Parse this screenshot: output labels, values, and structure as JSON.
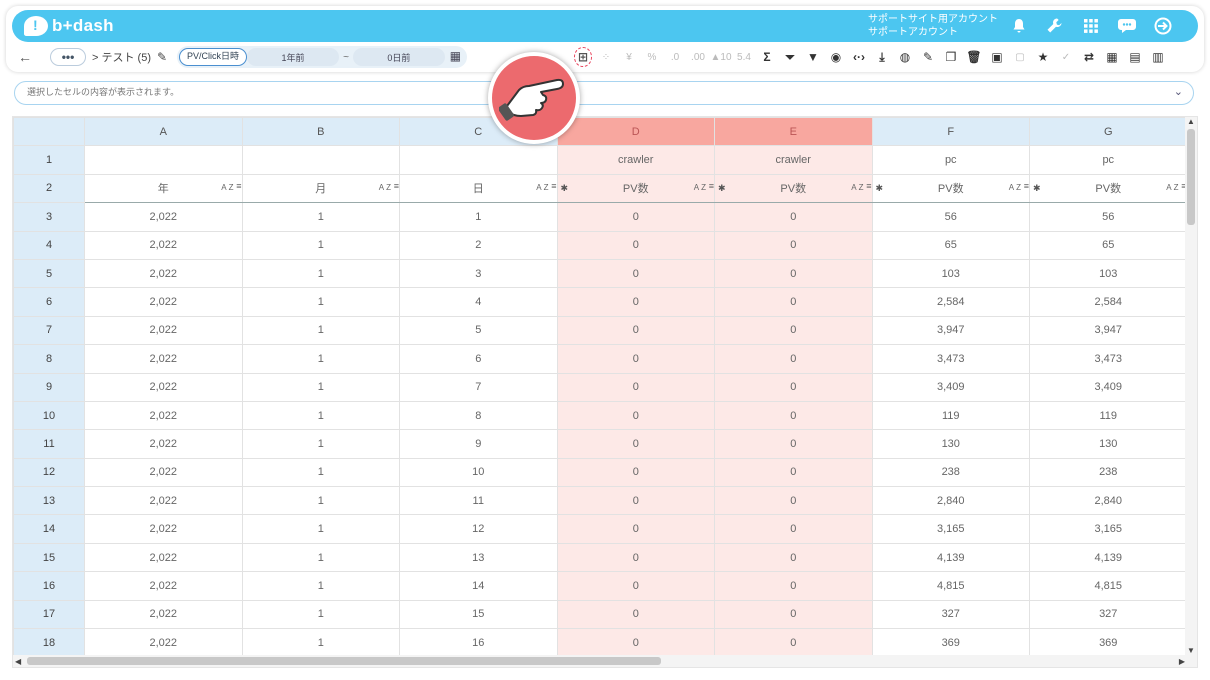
{
  "app": {
    "brand": "b+dash"
  },
  "account": {
    "line1": "サポートサイト用アカウント",
    "line2": "サポートアカウント"
  },
  "toolbar": {
    "back": "←",
    "more": "•••",
    "breadcrumb": "> テスト (5)",
    "date_type": "PV/Click日時",
    "date_from": "1年前",
    "date_sep": "~",
    "date_to": "0日前"
  },
  "tools": [
    {
      "name": "layout-icon",
      "glyph": "⊞"
    },
    {
      "name": "spinner-icon",
      "glyph": "⁘"
    },
    {
      "name": "yen-icon",
      "glyph": "¥"
    },
    {
      "name": "percent-icon",
      "glyph": "%"
    },
    {
      "name": "decimal-decrease-icon",
      "glyph": ".0"
    },
    {
      "name": "decimal-increase-icon",
      "glyph": ".00"
    },
    {
      "name": "increase-icon",
      "glyph": "▲10"
    },
    {
      "name": "decrease-icon",
      "glyph": "5.4"
    },
    {
      "name": "sum-icon",
      "glyph": "Σ"
    },
    {
      "name": "filter-clear-icon",
      "glyph": "⏷"
    },
    {
      "name": "filter-icon",
      "glyph": "▼"
    },
    {
      "name": "eye-icon",
      "glyph": "◉"
    },
    {
      "name": "code-icon",
      "glyph": "‹·›"
    },
    {
      "name": "download-icon",
      "glyph": "⤓"
    },
    {
      "name": "chart-icon",
      "glyph": "◍"
    },
    {
      "name": "edit-icon",
      "glyph": "✎"
    },
    {
      "name": "copy-icon",
      "glyph": "❐"
    },
    {
      "name": "trash-icon",
      "glyph": "🗑"
    },
    {
      "name": "archive-icon",
      "glyph": "▣"
    },
    {
      "name": "archive-disabled-icon",
      "glyph": "▢"
    },
    {
      "name": "star-icon",
      "glyph": "★"
    },
    {
      "name": "user-check-icon",
      "glyph": "✓"
    },
    {
      "name": "swap-icon",
      "glyph": "⇄"
    },
    {
      "name": "calendar-icon",
      "glyph": "▦"
    },
    {
      "name": "document-icon",
      "glyph": "▤"
    },
    {
      "name": "clipboard-icon",
      "glyph": "▥"
    }
  ],
  "message_bar": {
    "text": "選択したセルの内容が表示されます。"
  },
  "grid": {
    "columns": [
      "A",
      "B",
      "C",
      "D",
      "E",
      "F",
      "G"
    ],
    "group_row": [
      "",
      "",
      "",
      "crawler",
      "crawler",
      "pc",
      "pc"
    ],
    "header_row": [
      "年",
      "月",
      "日",
      "PV数",
      "PV数",
      "PV数",
      "PV数"
    ],
    "sort_label": "AZ",
    "rows": [
      {
        "n": "3",
        "cells": [
          "2,022",
          "1",
          "1",
          "0",
          "0",
          "56",
          "56"
        ]
      },
      {
        "n": "4",
        "cells": [
          "2,022",
          "1",
          "2",
          "0",
          "0",
          "65",
          "65"
        ]
      },
      {
        "n": "5",
        "cells": [
          "2,022",
          "1",
          "3",
          "0",
          "0",
          "103",
          "103"
        ]
      },
      {
        "n": "6",
        "cells": [
          "2,022",
          "1",
          "4",
          "0",
          "0",
          "2,584",
          "2,584"
        ]
      },
      {
        "n": "7",
        "cells": [
          "2,022",
          "1",
          "5",
          "0",
          "0",
          "3,947",
          "3,947"
        ]
      },
      {
        "n": "8",
        "cells": [
          "2,022",
          "1",
          "6",
          "0",
          "0",
          "3,473",
          "3,473"
        ]
      },
      {
        "n": "9",
        "cells": [
          "2,022",
          "1",
          "7",
          "0",
          "0",
          "3,409",
          "3,409"
        ]
      },
      {
        "n": "10",
        "cells": [
          "2,022",
          "1",
          "8",
          "0",
          "0",
          "119",
          "119"
        ]
      },
      {
        "n": "11",
        "cells": [
          "2,022",
          "1",
          "9",
          "0",
          "0",
          "130",
          "130"
        ]
      },
      {
        "n": "12",
        "cells": [
          "2,022",
          "1",
          "10",
          "0",
          "0",
          "238",
          "238"
        ]
      },
      {
        "n": "13",
        "cells": [
          "2,022",
          "1",
          "11",
          "0",
          "0",
          "2,840",
          "2,840"
        ]
      },
      {
        "n": "14",
        "cells": [
          "2,022",
          "1",
          "12",
          "0",
          "0",
          "3,165",
          "3,165"
        ]
      },
      {
        "n": "15",
        "cells": [
          "2,022",
          "1",
          "13",
          "0",
          "0",
          "4,139",
          "4,139"
        ]
      },
      {
        "n": "16",
        "cells": [
          "2,022",
          "1",
          "14",
          "0",
          "0",
          "4,815",
          "4,815"
        ]
      },
      {
        "n": "17",
        "cells": [
          "2,022",
          "1",
          "15",
          "0",
          "0",
          "327",
          "327"
        ]
      },
      {
        "n": "18",
        "cells": [
          "2,022",
          "1",
          "16",
          "0",
          "0",
          "369",
          "369"
        ]
      }
    ],
    "selected_columns": [
      "D",
      "E"
    ]
  },
  "colors": {
    "brand": "#4cc6f0",
    "selected_header": "#f8a79f",
    "selected_cell": "#fde9e7",
    "pointer": "#ec6a6e"
  }
}
